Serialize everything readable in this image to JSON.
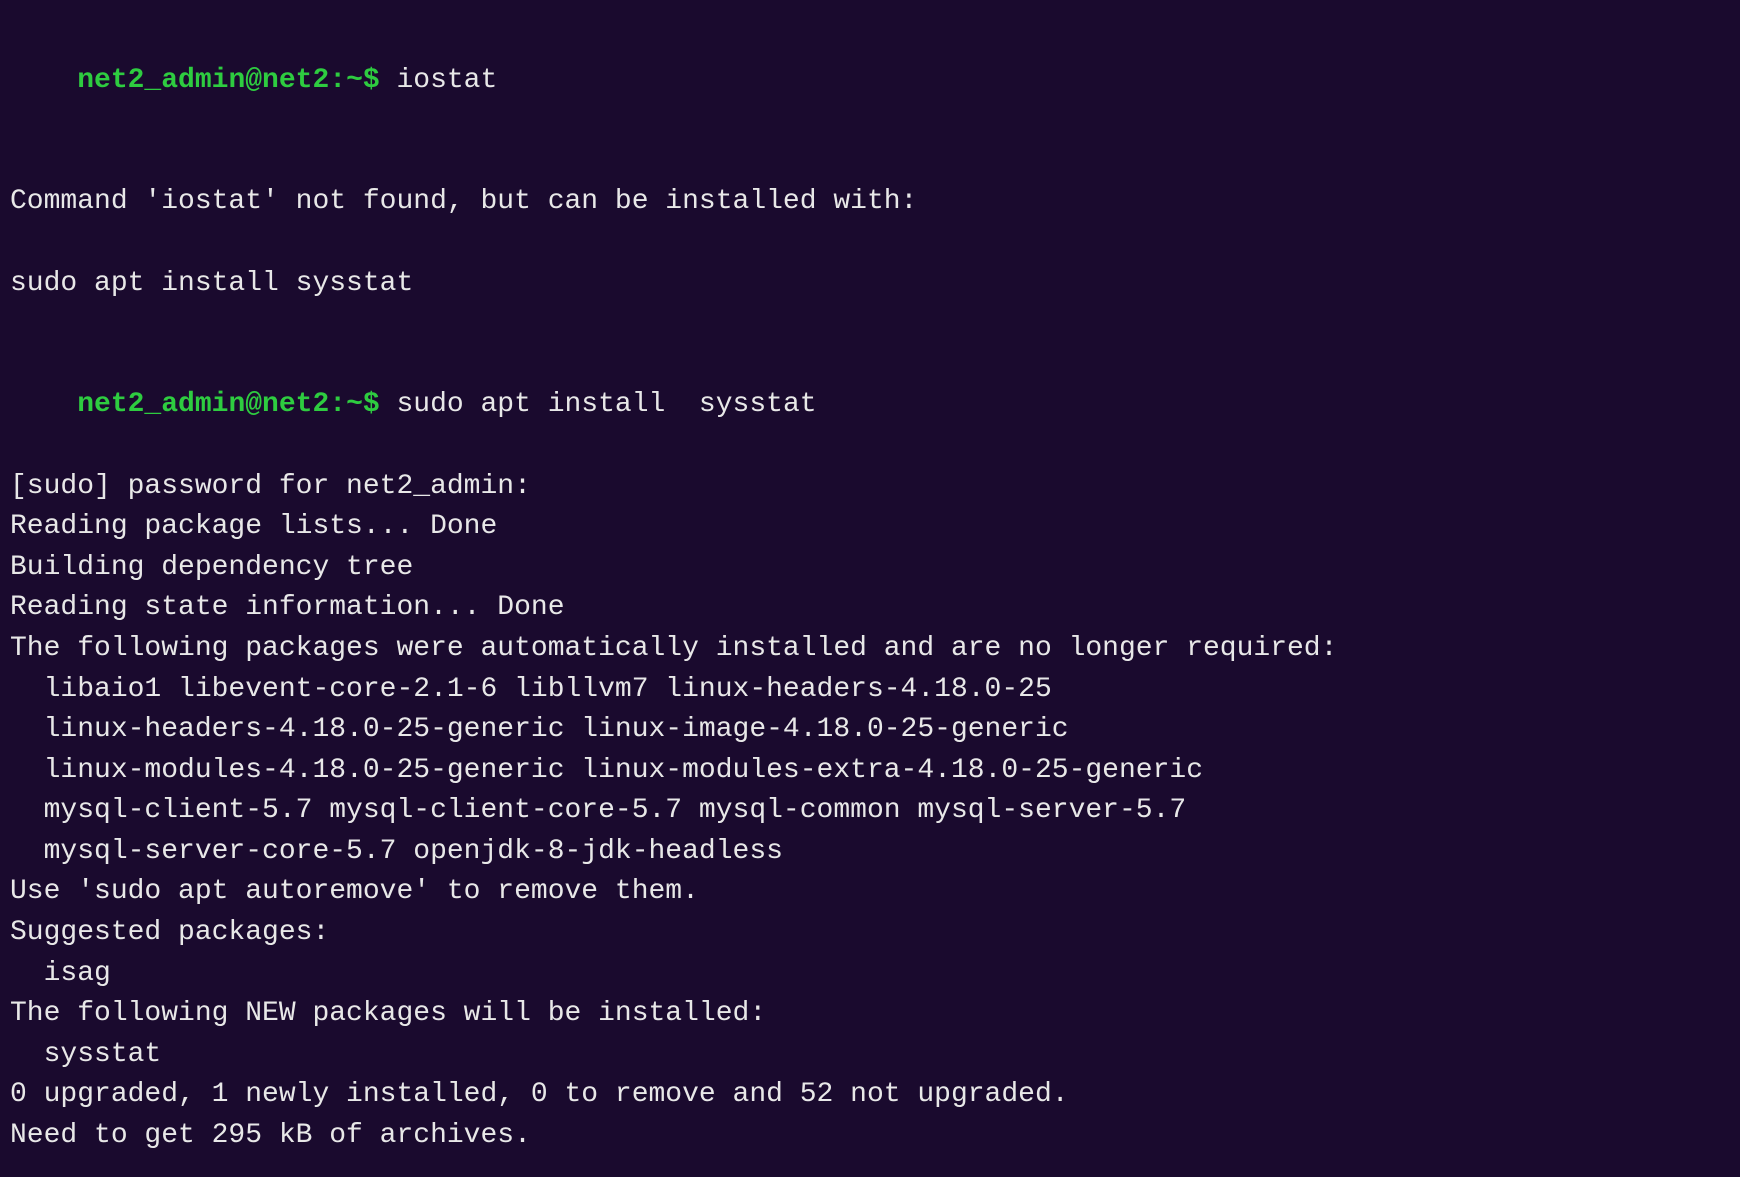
{
  "terminal": {
    "lines": [
      {
        "id": "l1",
        "type": "prompt-command",
        "prompt": "net2_admin@net2:~$ ",
        "command": "iostat"
      },
      {
        "id": "l2",
        "type": "empty"
      },
      {
        "id": "l3",
        "type": "text",
        "content": "Command 'iostat' not found, but can be installed with:"
      },
      {
        "id": "l4",
        "type": "empty"
      },
      {
        "id": "l5",
        "type": "text",
        "content": "sudo apt install sysstat"
      },
      {
        "id": "l6",
        "type": "empty"
      },
      {
        "id": "l7",
        "type": "prompt-command",
        "prompt": "net2_admin@net2:~$ ",
        "command": "sudo apt install  sysstat"
      },
      {
        "id": "l8",
        "type": "text",
        "content": "[sudo] password for net2_admin:"
      },
      {
        "id": "l9",
        "type": "text",
        "content": "Reading package lists... Done"
      },
      {
        "id": "l10",
        "type": "text",
        "content": "Building dependency tree"
      },
      {
        "id": "l11",
        "type": "text",
        "content": "Reading state information... Done"
      },
      {
        "id": "l12",
        "type": "text",
        "content": "The following packages were automatically installed and are no longer required:"
      },
      {
        "id": "l13",
        "type": "text-indent",
        "content": "  libaio1 libevent-core-2.1-6 libllvm7 linux-headers-4.18.0-25"
      },
      {
        "id": "l14",
        "type": "text-indent",
        "content": "  linux-headers-4.18.0-25-generic linux-image-4.18.0-25-generic"
      },
      {
        "id": "l15",
        "type": "text-indent",
        "content": "  linux-modules-4.18.0-25-generic linux-modules-extra-4.18.0-25-generic"
      },
      {
        "id": "l16",
        "type": "text-indent",
        "content": "  mysql-client-5.7 mysql-client-core-5.7 mysql-common mysql-server-5.7"
      },
      {
        "id": "l17",
        "type": "text-indent",
        "content": "  mysql-server-core-5.7 openjdk-8-jdk-headless"
      },
      {
        "id": "l18",
        "type": "text",
        "content": "Use 'sudo apt autoremove' to remove them."
      },
      {
        "id": "l19",
        "type": "text",
        "content": "Suggested packages:"
      },
      {
        "id": "l20",
        "type": "text-indent",
        "content": "  isag"
      },
      {
        "id": "l21",
        "type": "text",
        "content": "The following NEW packages will be installed:"
      },
      {
        "id": "l22",
        "type": "text-indent",
        "content": "  sysstat"
      },
      {
        "id": "l23",
        "type": "text",
        "content": "0 upgraded, 1 newly installed, 0 to remove and 52 not upgraded."
      },
      {
        "id": "l24",
        "type": "text",
        "content": "Need to get 295 kB of archives."
      }
    ]
  }
}
